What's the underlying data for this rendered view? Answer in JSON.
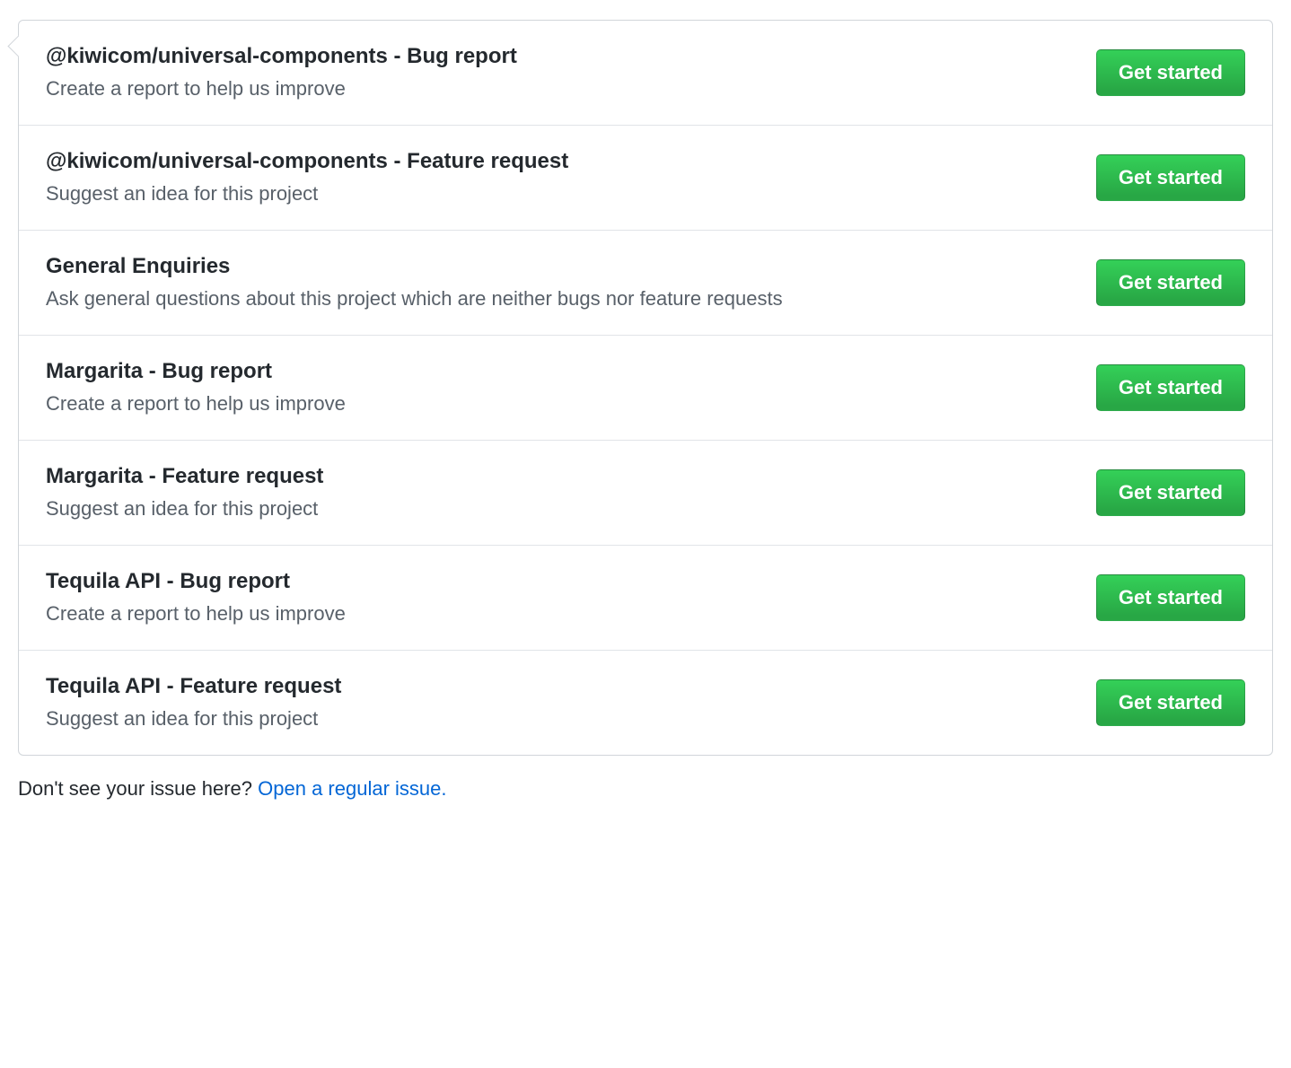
{
  "templates": [
    {
      "title": "@kiwicom/universal-components - Bug report",
      "description": "Create a report to help us improve",
      "button_label": "Get started"
    },
    {
      "title": "@kiwicom/universal-components - Feature request",
      "description": "Suggest an idea for this project",
      "button_label": "Get started"
    },
    {
      "title": "General Enquiries",
      "description": "Ask general questions about this project which are neither bugs nor feature requests",
      "button_label": "Get started"
    },
    {
      "title": "Margarita - Bug report",
      "description": "Create a report to help us improve",
      "button_label": "Get started"
    },
    {
      "title": "Margarita - Feature request",
      "description": "Suggest an idea for this project",
      "button_label": "Get started"
    },
    {
      "title": "Tequila API - Bug report",
      "description": "Create a report to help us improve",
      "button_label": "Get started"
    },
    {
      "title": "Tequila API - Feature request",
      "description": "Suggest an idea for this project",
      "button_label": "Get started"
    }
  ],
  "footer": {
    "prompt": "Don't see your issue here? ",
    "link_text": "Open a regular issue."
  }
}
